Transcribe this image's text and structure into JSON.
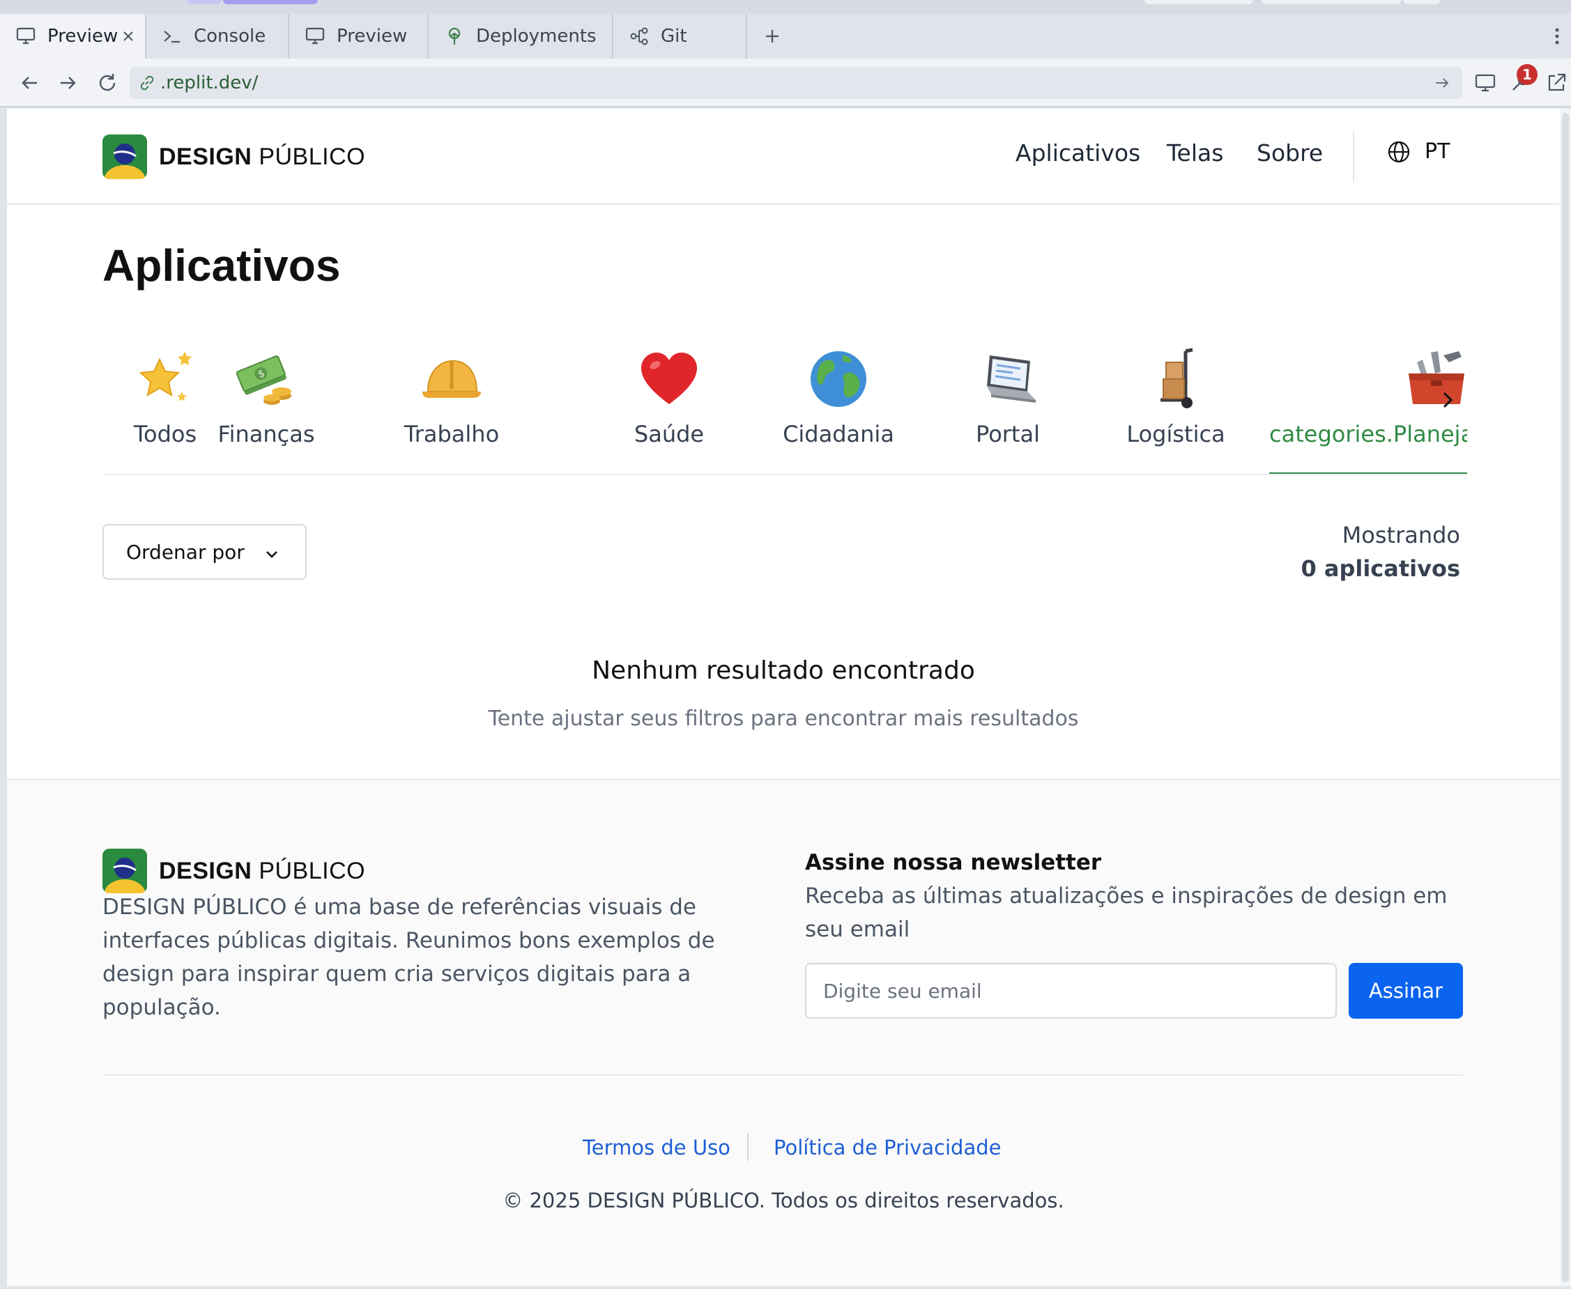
{
  "browser": {
    "tabs": [
      {
        "label": "Preview",
        "icon": "monitor-icon",
        "active": true
      },
      {
        "label": "Console",
        "icon": "terminal-icon"
      },
      {
        "label": "Preview",
        "icon": "monitor-icon"
      },
      {
        "label": "Deployments",
        "icon": "deploy-icon"
      },
      {
        "label": "Git",
        "icon": "git-icon"
      }
    ],
    "url": ".replit.dev/",
    "notification_count": "1"
  },
  "site": {
    "logo": {
      "bold": "DESIGN",
      "rest": "PÚBLICO"
    },
    "nav": [
      "Aplicativos",
      "Telas",
      "Sobre"
    ],
    "language": "PT"
  },
  "main": {
    "title": "Aplicativos",
    "categories": [
      {
        "label": "Todos",
        "icon": "star-icon"
      },
      {
        "label": "Finanças",
        "icon": "money-icon"
      },
      {
        "label": "Trabalho",
        "icon": "helmet-icon"
      },
      {
        "label": "Saúde",
        "icon": "heart-icon"
      },
      {
        "label": "Cidadania",
        "icon": "globe-icon"
      },
      {
        "label": "Portal",
        "icon": "laptop-icon"
      },
      {
        "label": "Logística",
        "icon": "hand-truck-icon"
      },
      {
        "label": "categories.Planejamento",
        "icon": "toolbox-icon",
        "active": true
      }
    ],
    "sort_label": "Ordenar por",
    "showing_label": "Mostrando",
    "showing_count": "0 aplicativos",
    "empty_title": "Nenhum resultado encontrado",
    "empty_text": "Tente ajustar seus filtros para encontrar mais resultados"
  },
  "footer": {
    "description": "DESIGN PÚBLICO é uma base de referências visuais de interfaces públicas digitais. Reunimos bons exemplos de design para inspirar quem cria serviços digitais para a população.",
    "newsletter_title": "Assine nossa newsletter",
    "newsletter_text": "Receba as últimas atualizações e inspirações de design em seu email",
    "email_placeholder": "Digite seu email",
    "subscribe_label": "Assinar",
    "terms": "Termos de Uso",
    "privacy": "Política de Privacidade",
    "copyright": "© 2025 DESIGN PÚBLICO. Todos os direitos reservados."
  },
  "colors": {
    "accent_green": "#2f8a45",
    "primary_blue": "#0b64f0",
    "link_blue": "#1d5fd6"
  }
}
